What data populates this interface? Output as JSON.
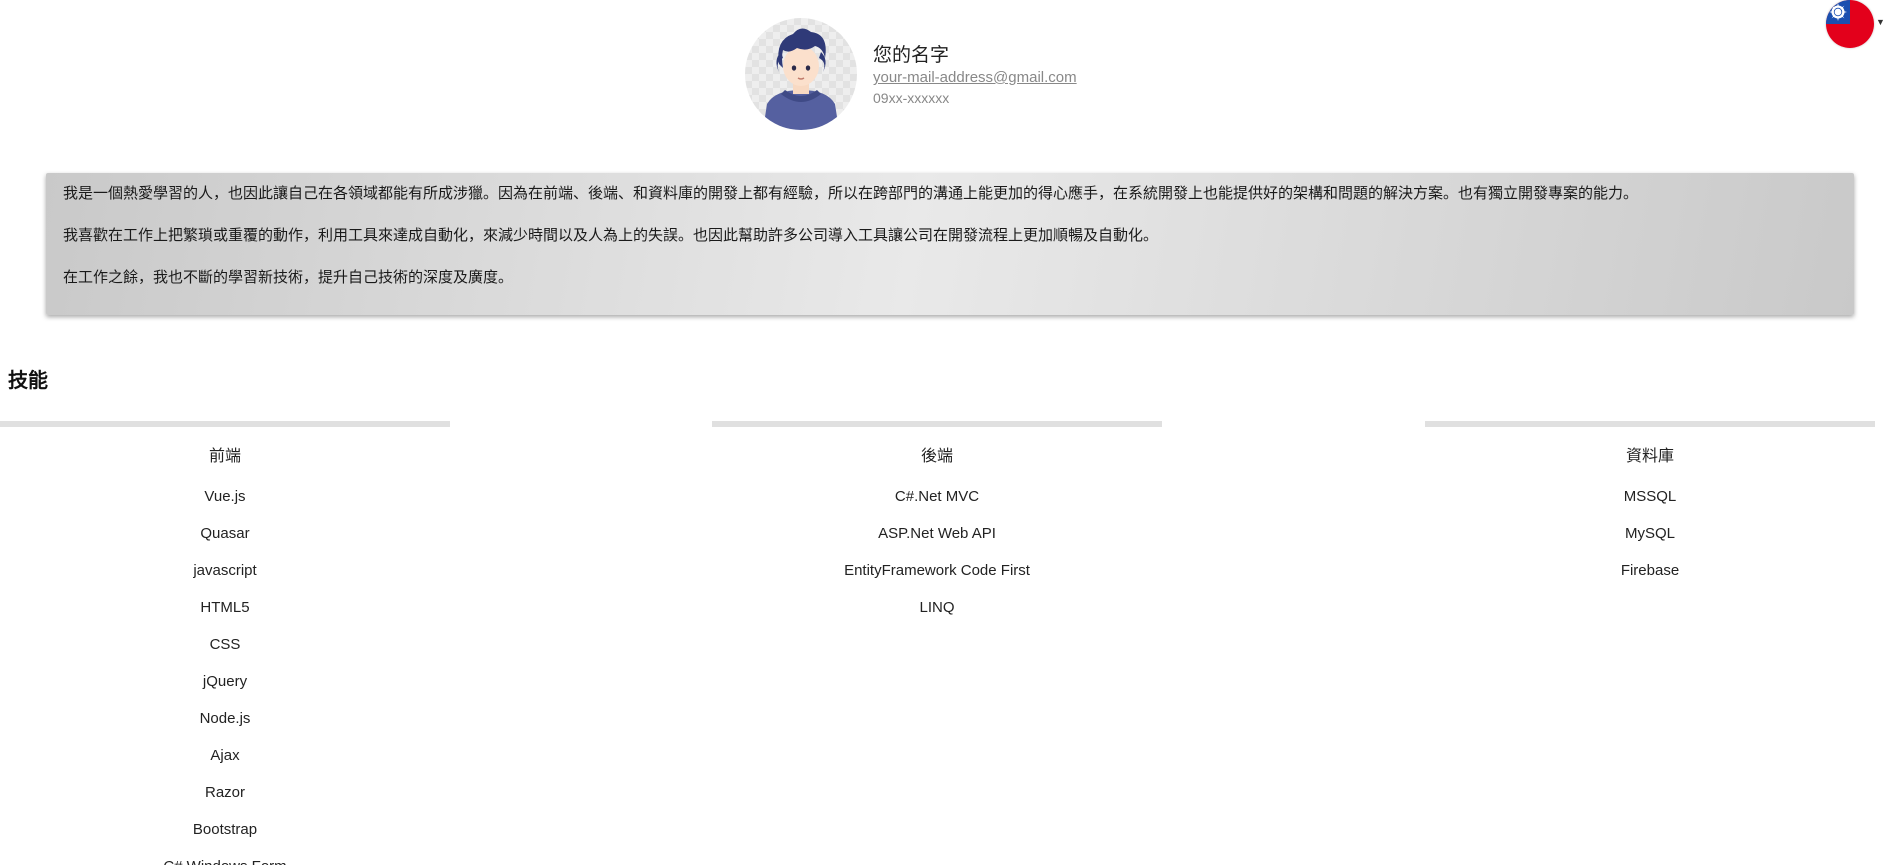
{
  "profile": {
    "name": "您的名字",
    "email": "your-mail-address@gmail.com",
    "phone": "09xx-xxxxxx"
  },
  "language": {
    "current": "Taiwan flag",
    "flag_colors": {
      "red": "#e3001b",
      "blue": "#1a4fb0",
      "white": "#ffffff"
    }
  },
  "intro": {
    "paragraphs": [
      "我是一個熱愛學習的人，也因此讓自己在各領域都能有所成涉獵。因為在前端、後端、和資料庫的開發上都有經驗，所以在跨部門的溝通上能更加的得心應手，在系統開發上也能提供好的架構和問題的解決方案。也有獨立開發專案的能力。",
      "我喜歡在工作上把繁瑣或重覆的動作，利用工具來達成自動化，來減少時間以及人為上的失誤。也因此幫助許多公司導入工具讓公司在開發流程上更加順暢及自動化。",
      "在工作之餘，我也不斷的學習新技術，提升自己技術的深度及廣度。"
    ]
  },
  "skills": {
    "title": "技能",
    "columns": [
      {
        "title": "前端",
        "items": [
          "Vue.js",
          "Quasar",
          "javascript",
          "HTML5",
          "CSS",
          "jQuery",
          "Node.js",
          "Ajax",
          "Razor",
          "Bootstrap",
          "C# Windows Form"
        ]
      },
      {
        "title": "後端",
        "items": [
          "C#.Net MVC",
          "ASP.Net Web API",
          "EntityFramework Code First",
          "LINQ"
        ]
      },
      {
        "title": "資料庫",
        "items": [
          "MSSQL",
          "MySQL",
          "Firebase"
        ]
      }
    ]
  }
}
